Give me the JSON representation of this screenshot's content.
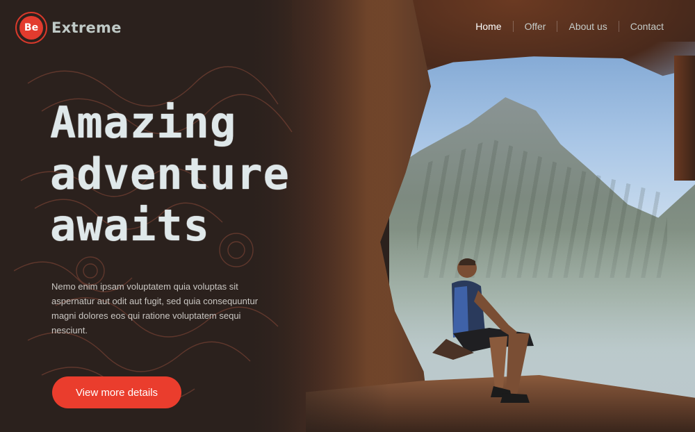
{
  "brand": {
    "badge": "Be",
    "name": "Extreme"
  },
  "nav": {
    "items": [
      {
        "label": "Home",
        "active": true
      },
      {
        "label": "Offer"
      },
      {
        "label": "About us"
      },
      {
        "label": "Contact"
      }
    ]
  },
  "hero": {
    "headline_lines": [
      "Amazing",
      "adventure",
      "awaits"
    ],
    "description": "Nemo enim ipsam voluptatem quia voluptas sit aspernatur aut odit aut fugit, sed quia consequuntur magni dolores eos qui ratione voluptatem sequi nesciunt.",
    "cta_label": "View more details"
  },
  "colors": {
    "accent": "#ea3d2d",
    "background": "#2b211d",
    "headline": "#dfe8ea"
  }
}
